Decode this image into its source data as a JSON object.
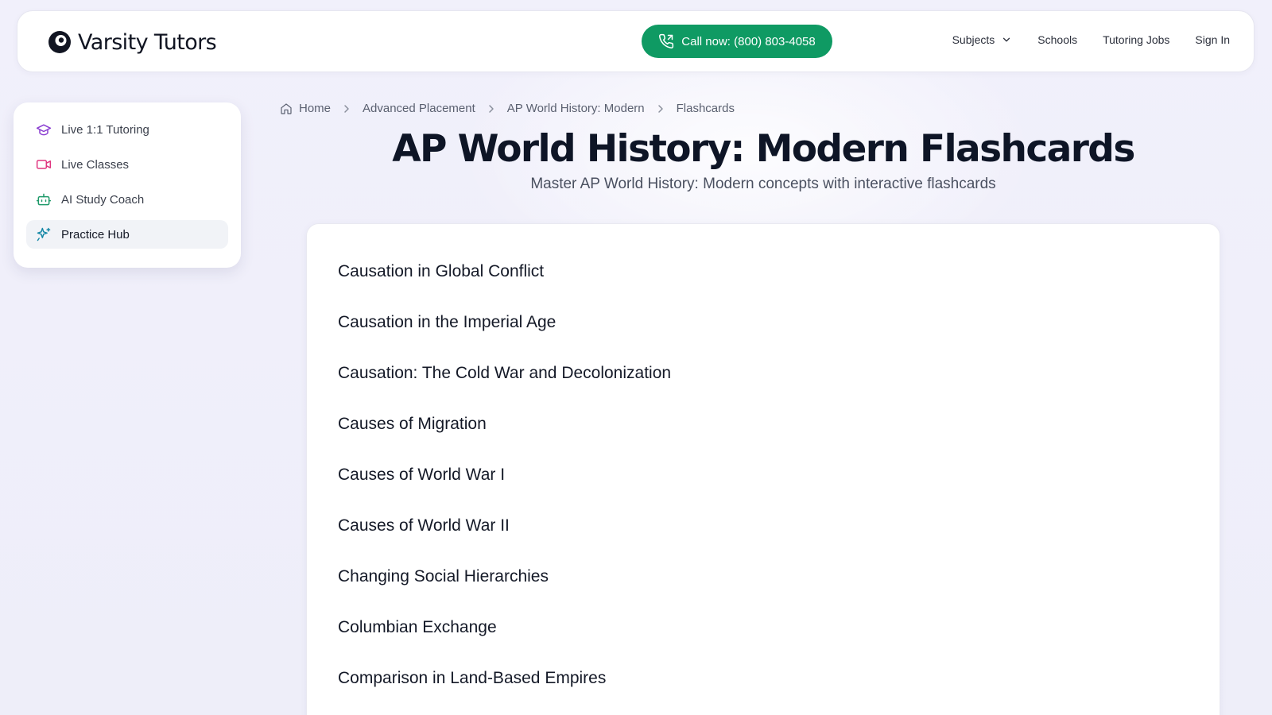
{
  "header": {
    "logo_text": "Varsity Tutors",
    "call_label": "Call now: (800) 803-4058",
    "nav": {
      "subjects": "Subjects",
      "schools": "Schools",
      "jobs": "Tutoring Jobs",
      "sign_in": "Sign In"
    }
  },
  "sidebar": {
    "items": [
      {
        "label": "Live 1:1 Tutoring",
        "icon": "graduation-cap-icon",
        "color": "#8b3fd1"
      },
      {
        "label": "Live Classes",
        "icon": "video-icon",
        "color": "#e0357f"
      },
      {
        "label": "AI Study Coach",
        "icon": "robot-icon",
        "color": "#1f9a6a"
      },
      {
        "label": "Practice Hub",
        "icon": "sparkles-icon",
        "color": "#1588a6",
        "active": true
      }
    ]
  },
  "breadcrumb": {
    "home": "Home",
    "level1": "Advanced Placement",
    "level2": "AP World History: Modern",
    "level3": "Flashcards"
  },
  "page": {
    "title": "AP World History: Modern Flashcards",
    "subtitle": "Master AP World History: Modern concepts with interactive flashcards"
  },
  "topics": [
    "Causation in Global Conflict",
    "Causation in the Imperial Age",
    "Causation: The Cold War and Decolonization",
    "Causes of Migration",
    "Causes of World War I",
    "Causes of World War II",
    "Changing Social Hierarchies",
    "Columbian Exchange",
    "Comparison in Land-Based Empires"
  ],
  "colors": {
    "accent_green": "#0f9a63",
    "title": "#0e1526"
  }
}
